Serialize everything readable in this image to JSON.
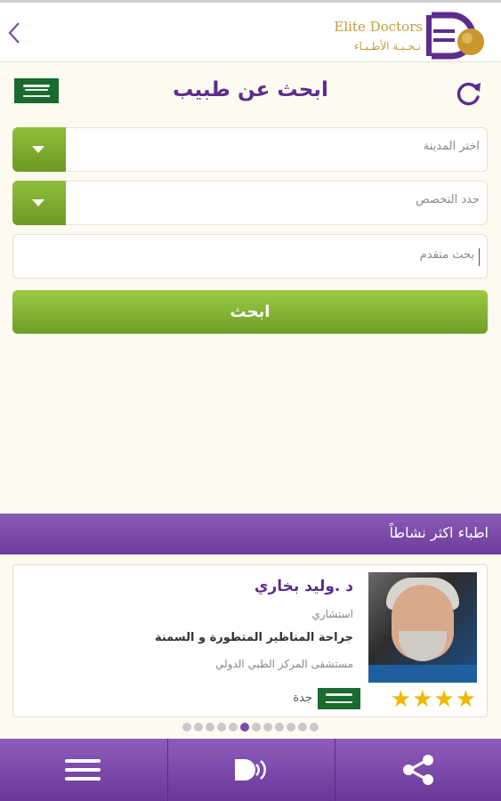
{
  "header": {
    "back_icon": "chevron-left-icon",
    "logo_text_en": "Elite Doctors",
    "logo_text_ar": "نـخـبـة الأطـبـاء",
    "logo_icon": "elite-doctors-logo"
  },
  "search": {
    "title": "ابحث عن طبيب",
    "refresh_icon": "refresh-icon",
    "country_flag": "saudi-flag-icon",
    "city_placeholder": "اختر المدينة",
    "specialty_placeholder": "حدد التخصص",
    "advanced_placeholder": "بحث متقدم",
    "search_button": "ابحث"
  },
  "active_section": {
    "title": "اطباء اكثر نشاطاً"
  },
  "doctor_card": {
    "name": "د .وليد بخاري",
    "title": "استشاري",
    "specialty": "جراحة المناظير المتطورة و السمنة",
    "hospital": "مستشفى المركز الطبي الدولي",
    "city": "جدة",
    "rating": 4,
    "rating_text": "★★★★"
  },
  "carousel": {
    "total": 12,
    "active_index": 5
  },
  "bottom_nav": {
    "items": [
      {
        "icon": "menu-icon"
      },
      {
        "icon": "elite-doctors-sound-icon"
      },
      {
        "icon": "share-icon"
      }
    ]
  },
  "colors": {
    "accent": "#5b2d8e",
    "green": "#7bab2e",
    "gold": "#c99a3a"
  }
}
